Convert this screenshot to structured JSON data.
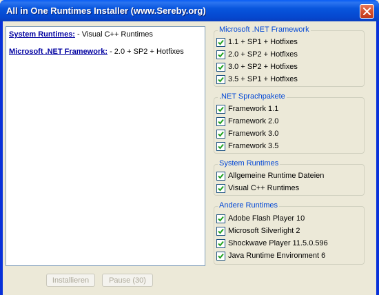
{
  "window": {
    "title": "All in One Runtimes Installer (www.Sereby.org)"
  },
  "summary": [
    {
      "label": "System Runtimes:",
      "detail": " - Visual C++ Runtimes"
    },
    {
      "label": "Microsoft .NET Framework:",
      "detail": " - 2.0 + SP2 + Hotfixes"
    }
  ],
  "buttons": {
    "install": "Installieren",
    "pause": "Pause (30)"
  },
  "groups": {
    "net_framework": {
      "title": "Microsoft .NET Framework",
      "items": [
        {
          "label": "1.1 + SP1 + Hotfixes",
          "checked": true
        },
        {
          "label": "2.0 + SP2 + Hotfixes",
          "checked": true
        },
        {
          "label": "3.0 + SP2 + Hotfixes",
          "checked": true
        },
        {
          "label": "3.5 + SP1 + Hotfixes",
          "checked": true
        }
      ]
    },
    "language_packs": {
      "title": ".NET Sprachpakete",
      "items": [
        {
          "label": "Framework 1.1",
          "checked": true
        },
        {
          "label": "Framework 2.0",
          "checked": true
        },
        {
          "label": "Framework 3.0",
          "checked": true
        },
        {
          "label": "Framework 3.5",
          "checked": true
        }
      ]
    },
    "system_runtimes": {
      "title": "System Runtimes",
      "items": [
        {
          "label": "Allgemeine Runtime Dateien",
          "checked": true
        },
        {
          "label": "Visual C++ Runtimes",
          "checked": true
        }
      ]
    },
    "other_runtimes": {
      "title": "Andere Runtimes",
      "items": [
        {
          "label": "Adobe Flash Player 10",
          "checked": true
        },
        {
          "label": "Microsoft Silverlight 2",
          "checked": true
        },
        {
          "label": "Shockwave Player 11.5.0.596",
          "checked": true
        },
        {
          "label": "Java Runtime Environment 6",
          "checked": true
        }
      ]
    }
  },
  "colors": {
    "titlebar": "#0855dd",
    "group_title": "#0046d5",
    "link": "#0000a0",
    "checkmark": "#21a121",
    "close_button": "#d4512e"
  }
}
